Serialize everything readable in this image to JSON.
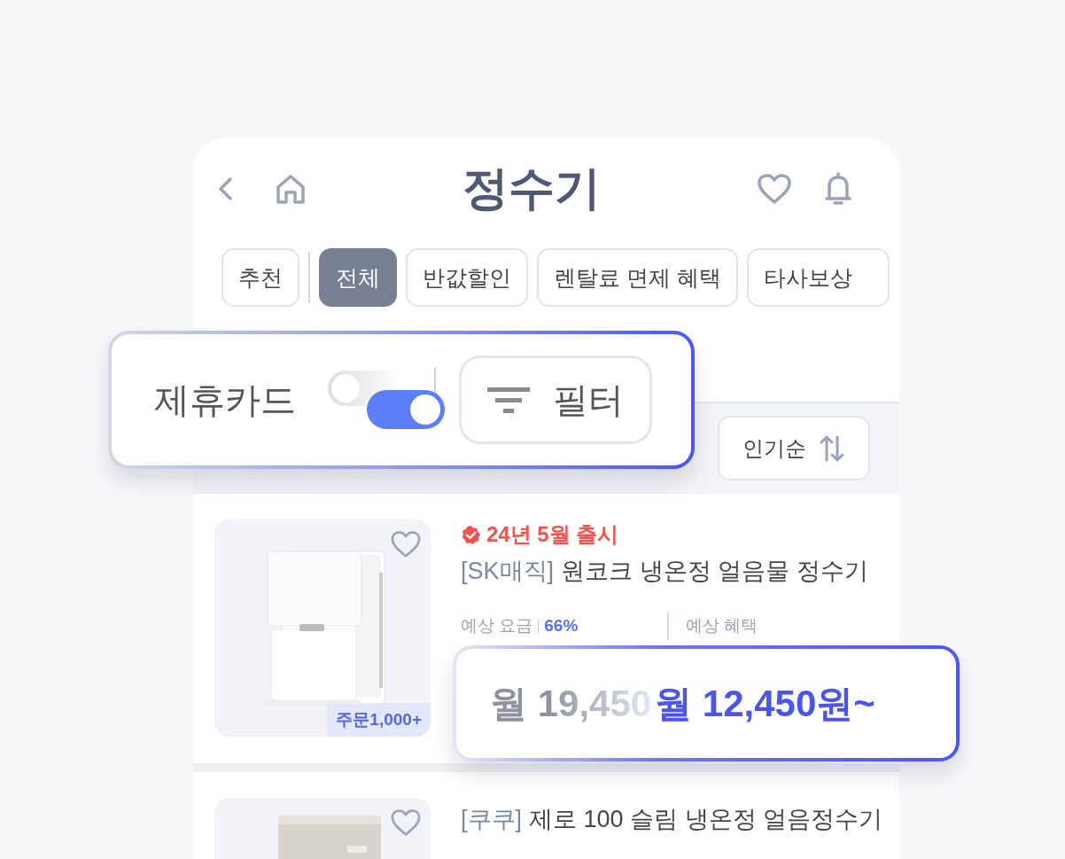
{
  "header": {
    "title": "정수기"
  },
  "chips": [
    {
      "label": "추천",
      "selected": false
    },
    {
      "label": "전체",
      "selected": true
    },
    {
      "label": "반값할인",
      "selected": false
    },
    {
      "label": "렌탈료 면제 혜택",
      "selected": false
    },
    {
      "label": "타사보상",
      "selected": false
    }
  ],
  "sort": {
    "label": "인기순"
  },
  "products": [
    {
      "kind": "purifier",
      "badge": "24년 5월 출시",
      "brand": "[SK매직]",
      "name": "원코크 냉온정 얼음물 정수기",
      "order_count": "주문1,000+",
      "fee_label": "예상 요금",
      "discount": "66%",
      "benefit_label": "예상 혜택"
    },
    {
      "kind": "box",
      "brand": "[쿠쿠]",
      "name": "제로 100 슬림 냉온정 얼음정수기"
    }
  ],
  "card_overlay": {
    "label": "제휴카드",
    "on": true,
    "filter_label": "필터"
  },
  "price_overlay": {
    "old_price": "월 19,450",
    "new_price": "월 12,450원~"
  }
}
